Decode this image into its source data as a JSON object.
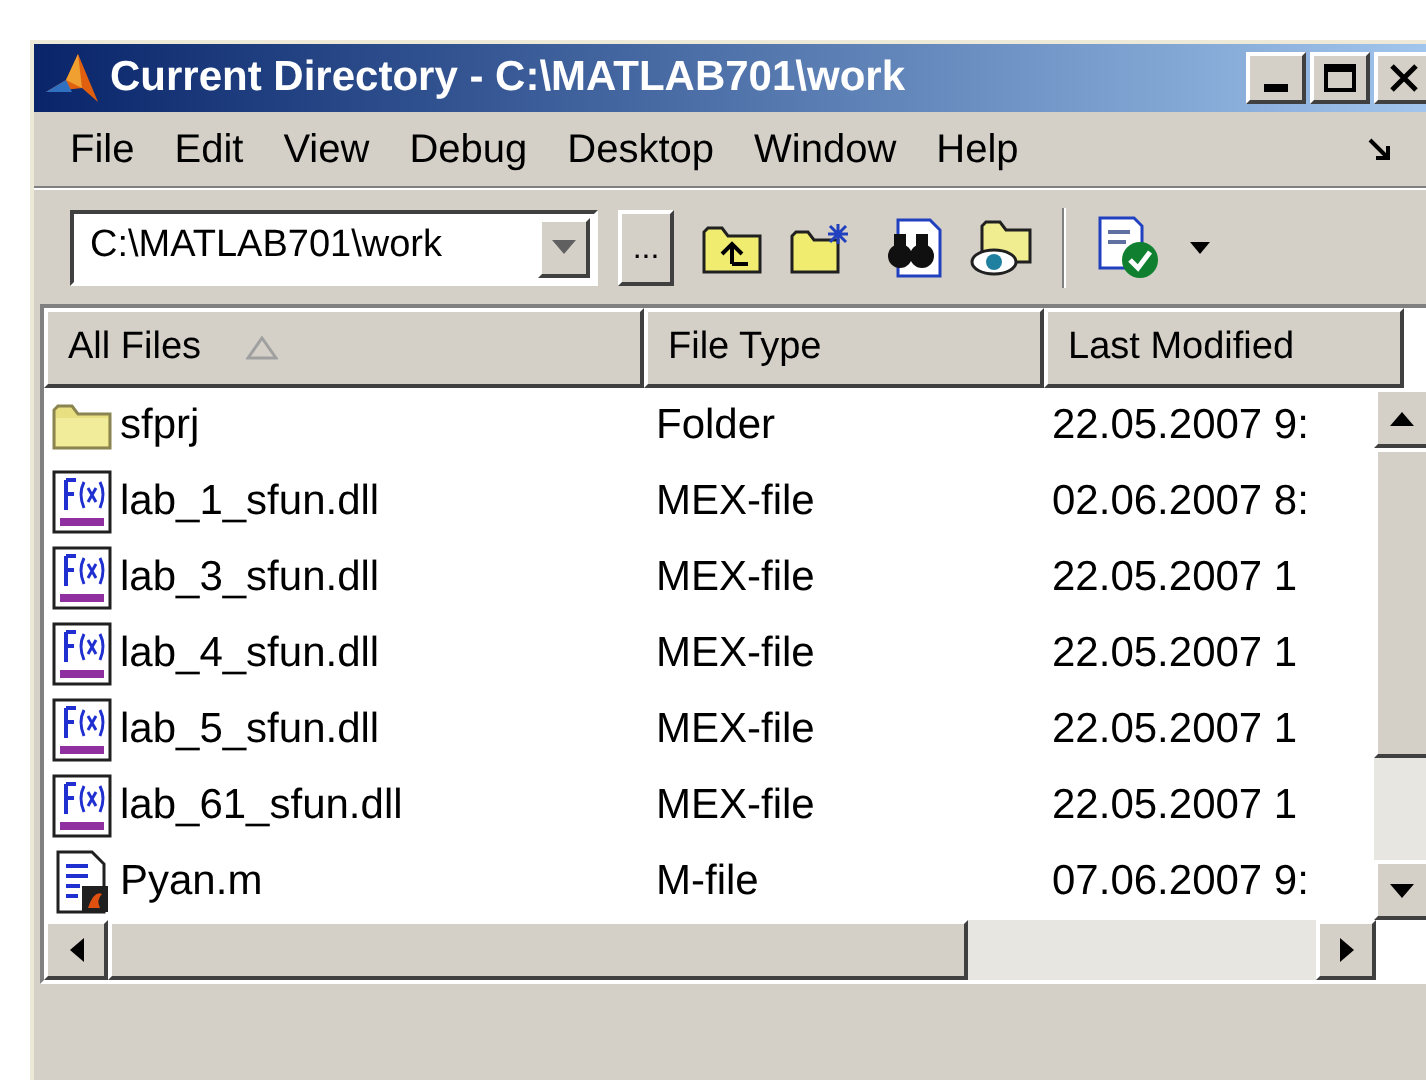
{
  "window": {
    "title": "Current Directory - C:\\MATLAB701\\work"
  },
  "menu": [
    "File",
    "Edit",
    "View",
    "Debug",
    "Desktop",
    "Window",
    "Help"
  ],
  "toolbar": {
    "path": "C:\\MATLAB701\\work",
    "browse": "..."
  },
  "table": {
    "columns": [
      {
        "label": "All Files",
        "sorted": true
      },
      {
        "label": "File Type",
        "sorted": false
      },
      {
        "label": "Last Modified",
        "sorted": false
      }
    ],
    "rows": [
      {
        "kind": "folder",
        "name": "sfprj",
        "type": "Folder",
        "modified": "22.05.2007 9:"
      },
      {
        "kind": "mex",
        "name": "lab_1_sfun.dll",
        "type": "MEX-file",
        "modified": "02.06.2007 8:"
      },
      {
        "kind": "mex",
        "name": "lab_3_sfun.dll",
        "type": "MEX-file",
        "modified": "22.05.2007 1"
      },
      {
        "kind": "mex",
        "name": "lab_4_sfun.dll",
        "type": "MEX-file",
        "modified": "22.05.2007 1"
      },
      {
        "kind": "mex",
        "name": "lab_5_sfun.dll",
        "type": "MEX-file",
        "modified": "22.05.2007 1"
      },
      {
        "kind": "mex",
        "name": "lab_61_sfun.dll",
        "type": "MEX-file",
        "modified": "22.05.2007 1"
      },
      {
        "kind": "mfile",
        "name": "Pyan.m",
        "type": "M-file",
        "modified": "07.06.2007 9:"
      }
    ]
  }
}
